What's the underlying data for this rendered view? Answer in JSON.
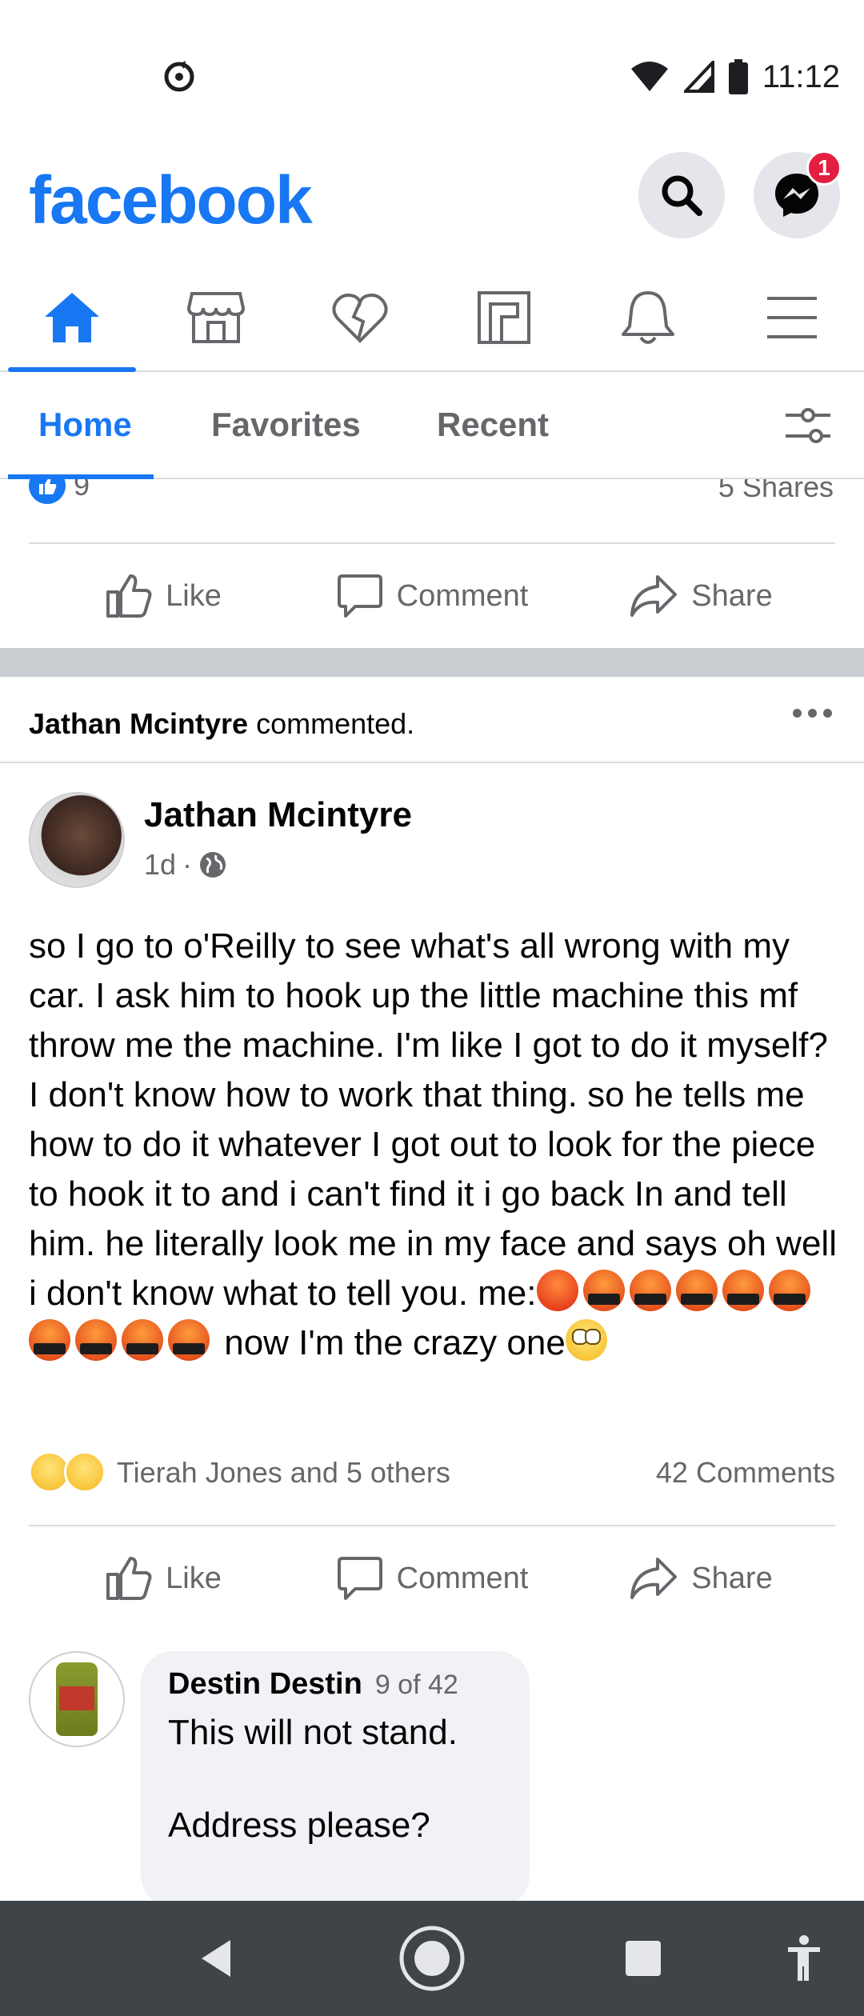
{
  "status_bar": {
    "time": "11:12",
    "icons": [
      "sync-icon",
      "wifi-icon",
      "signal-icon",
      "battery-icon"
    ]
  },
  "header": {
    "logo": "facebook",
    "brand_color": "#1877f2",
    "messenger_badge": "1"
  },
  "icon_nav": {
    "items": [
      "home-icon",
      "marketplace-icon",
      "dating-icon",
      "pages-icon",
      "notifications-icon",
      "menu-icon"
    ],
    "active": "home"
  },
  "feed_tabs": {
    "tabs": [
      {
        "label": "Home"
      },
      {
        "label": "Favorites"
      },
      {
        "label": "Recent"
      }
    ],
    "active": "Home"
  },
  "previous_post": {
    "like_count": "9",
    "shares": "5 Shares"
  },
  "actions": {
    "like": "Like",
    "comment": "Comment",
    "share": "Share"
  },
  "notice": {
    "actor": "Jathan Mcintyre",
    "action": " commented."
  },
  "post": {
    "author": "Jathan Mcintyre",
    "time": "1d",
    "separator": "·",
    "text": "so I go to o'Reilly to see what's all wrong with my car. I ask him to hook up the little machine this mf throw me the machine. I'm like I got to do it myself? I don't know how to work that thing. so he tells me how to do it whatever I got out to look for the piece to hook it to and i can't find it i go back In and tell him. he literally look me in my face and says oh well i don't know what to tell you. me:",
    "text_end": " now I'm the crazy one",
    "reactions_names": "Tierah Jones and 5 others",
    "comments_count": "42 Comments"
  },
  "comment": {
    "author": "Destin Destin",
    "index": "9 of 42",
    "text": "This will not stand.\n\nAddress please?"
  }
}
